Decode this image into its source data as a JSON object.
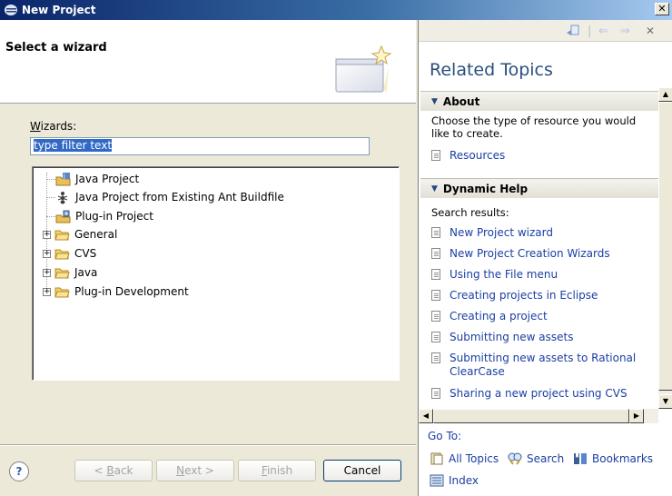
{
  "window": {
    "title": "New Project",
    "close": "✕"
  },
  "wizard": {
    "header_title": "Select a wizard",
    "wizards_label_prefix": "W",
    "wizards_label_rest": "izards:",
    "filter_value": "type filter text",
    "tree": [
      {
        "label": "Java Project",
        "icon": "java-project-icon",
        "expandable": false
      },
      {
        "label": "Java Project from Existing Ant Buildfile",
        "icon": "ant-icon",
        "expandable": false
      },
      {
        "label": "Plug-in Project",
        "icon": "plugin-icon",
        "expandable": false
      },
      {
        "label": "General",
        "icon": "folder-icon",
        "expandable": true
      },
      {
        "label": "CVS",
        "icon": "folder-icon",
        "expandable": true
      },
      {
        "label": "Java",
        "icon": "folder-icon",
        "expandable": true
      },
      {
        "label": "Plug-in Development",
        "icon": "folder-icon",
        "expandable": true
      }
    ]
  },
  "buttons": {
    "help": "?",
    "back_prefix": "< ",
    "back_u": "B",
    "back_rest": "ack",
    "next_u": "N",
    "next_rest": "ext >",
    "finish_u": "F",
    "finish_rest": "inish",
    "cancel": "Cancel"
  },
  "help": {
    "related_topics": "Related Topics",
    "about_title": "About",
    "about_text": "Choose the type of resource you would like to create.",
    "about_links": [
      "Resources"
    ],
    "dynamic_title": "Dynamic Help",
    "search_results": "Search results:",
    "results": [
      "New Project wizard",
      "New Project Creation Wizards",
      "Using the File menu",
      "Creating projects in Eclipse",
      "Creating a project",
      "Submitting new assets",
      "Submitting new assets to Rational ClearCase",
      "Sharing a new project using CVS"
    ],
    "goto": "Go To:",
    "all_topics": "All Topics",
    "search": "Search",
    "bookmarks": "Bookmarks",
    "index": "Index"
  }
}
